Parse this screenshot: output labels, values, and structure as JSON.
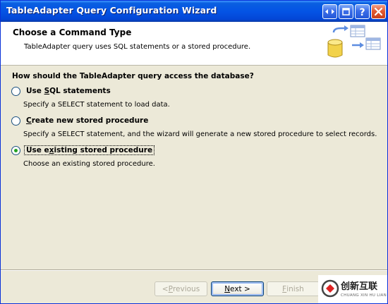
{
  "window": {
    "title": "TableAdapter Query Configuration Wizard",
    "controls": [
      "restore-icon",
      "minimize-icon",
      "help-icon",
      "close-icon"
    ]
  },
  "header": {
    "title": "Choose a Command Type",
    "subtitle": "TableAdapter query uses SQL statements or a stored procedure."
  },
  "question": "How should the TableAdapter query access the database?",
  "options": [
    {
      "pre": "Use ",
      "mn": "S",
      "post": "QL statements",
      "description": "Specify a SELECT statement to load data.",
      "checked": false
    },
    {
      "pre": "",
      "mn": "C",
      "post": "reate new stored procedure",
      "description": "Specify a SELECT statement, and the wizard will generate a new stored procedure to select records.",
      "checked": false
    },
    {
      "pre": "Use e",
      "mn": "x",
      "post": "isting stored procedure",
      "description": "Choose an existing stored procedure.",
      "checked": true
    }
  ],
  "buttons": {
    "previous": {
      "pre": "< ",
      "mn": "P",
      "post": "revious",
      "enabled": false
    },
    "next": {
      "pre": "",
      "mn": "N",
      "post": "ext >",
      "enabled": true
    },
    "finish": {
      "pre": "",
      "mn": "F",
      "post": "inish",
      "enabled": false
    }
  },
  "watermark": {
    "name": "创新互联",
    "tagline": "CHUANG XIN HU LIAN"
  },
  "colors": {
    "titlebar": "#0454e5",
    "dialog": "#ece9d8",
    "radio_dot": "#21a121",
    "disabled_text": "#aca899"
  }
}
